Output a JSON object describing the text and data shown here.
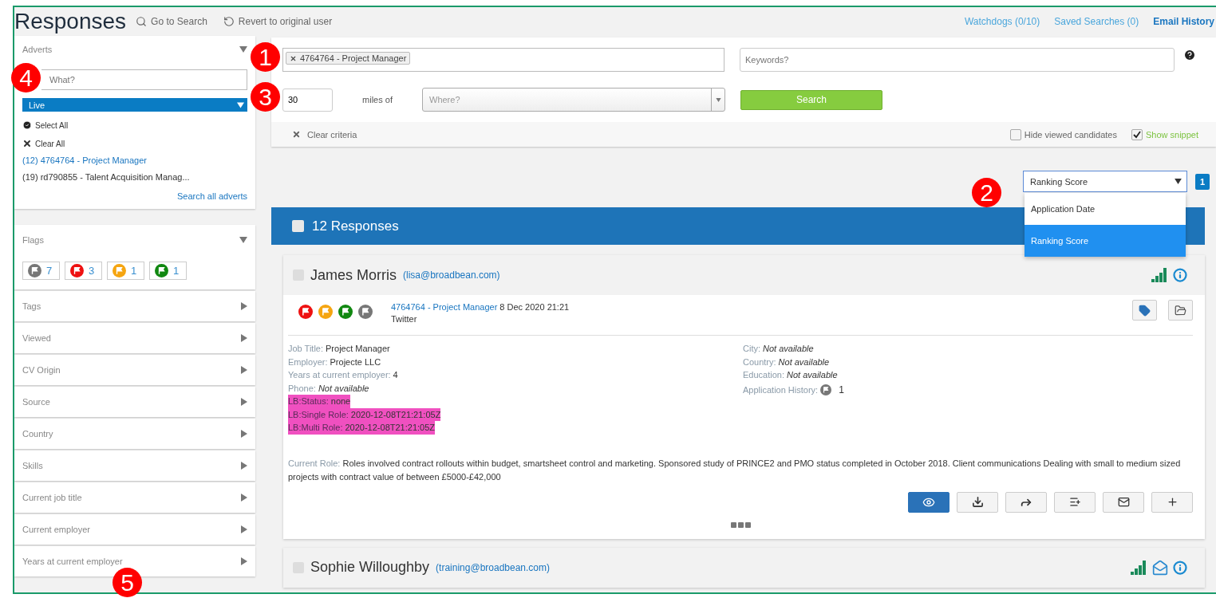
{
  "header": {
    "title": "Responses",
    "actions": [
      {
        "kind": "search",
        "label": "Go to Search"
      },
      {
        "kind": "revert",
        "label": "Revert to original user"
      }
    ],
    "links": [
      {
        "label": "Watchdogs (0/10)",
        "emphasis": false
      },
      {
        "label": "Saved Searches (0)",
        "emphasis": false
      },
      {
        "label": "Email History",
        "emphasis": true
      }
    ]
  },
  "adverts": {
    "title": "Adverts",
    "expanded": true,
    "what_placeholder": "What?",
    "status": "Live",
    "select_all": "Select All",
    "clear_all": "Clear All",
    "items": [
      {
        "count": "(12)",
        "label": "4764764 - Project Manager",
        "selected": true
      },
      {
        "count": "(19)",
        "label": "rd790855 - Talent Acquisition Manag...",
        "selected": false
      }
    ],
    "search_all": "Search all adverts"
  },
  "filters": [
    {
      "label": "Flags",
      "expanded": true,
      "flags": [
        {
          "color": "#777777",
          "count": "7"
        },
        {
          "color": "#ee1111",
          "count": "3"
        },
        {
          "color": "#f5a511",
          "count": "1"
        },
        {
          "color": "#118811",
          "count": "1"
        }
      ]
    },
    {
      "label": "Tags",
      "expanded": false
    },
    {
      "label": "Viewed",
      "expanded": false
    },
    {
      "label": "CV Origin",
      "expanded": false
    },
    {
      "label": "Source",
      "expanded": false
    },
    {
      "label": "Country",
      "expanded": false
    },
    {
      "label": "Skills",
      "expanded": false
    },
    {
      "label": "Current job title",
      "expanded": false
    },
    {
      "label": "Current employer",
      "expanded": false
    },
    {
      "label": "Years at current employer",
      "expanded": false
    }
  ],
  "search": {
    "advert_tags": [
      "4764764 - Project Manager"
    ],
    "keywords_placeholder": "Keywords?",
    "distance": "30",
    "distance_label": "miles of",
    "where_placeholder": "Where?",
    "button": "Search",
    "clear": "Clear criteria",
    "options": [
      {
        "label": "Hide viewed candidates",
        "checked": false
      },
      {
        "label": "Show snippet",
        "checked": true
      }
    ]
  },
  "sort": {
    "value": "Ranking Score",
    "options": [
      {
        "label": "Application Date",
        "selected": false
      },
      {
        "label": "Ranking Score",
        "selected": true
      }
    ],
    "page": "1"
  },
  "results": {
    "count_label": "12 Responses",
    "all_checked": false,
    "candidates": [
      {
        "name": "James Morris",
        "email": "(lisa@broadbean.com)",
        "checked": false,
        "emailed": false,
        "flags": [
          {
            "color": "#ee1111"
          },
          {
            "color": "#f5a511"
          },
          {
            "color": "#118811"
          },
          {
            "color": "#777777"
          }
        ],
        "advert": "4764764 - Project Manager",
        "date": "8 Dec 2020 21:21",
        "source": "Twitter",
        "details_left": [
          {
            "label": "Job Title:",
            "value": "Project Manager",
            "italic": false,
            "highlighted": false
          },
          {
            "label": "Employer:",
            "value": "Projecte LLC",
            "italic": false,
            "highlighted": false
          },
          {
            "label": "Years at current employer:",
            "value": "4",
            "italic": false,
            "highlighted": false
          },
          {
            "label": "Phone:",
            "value": "Not available",
            "italic": true,
            "highlighted": false
          },
          {
            "label": "LB:Status:",
            "value": "none",
            "italic": false,
            "highlighted": true
          },
          {
            "label": "LB:Single Role:",
            "value": "2020-12-08T21:21:05Z",
            "italic": false,
            "highlighted": true
          },
          {
            "label": "LB:Multi Role:",
            "value": "2020-12-08T21:21:05Z",
            "italic": false,
            "highlighted": true
          }
        ],
        "details_right": [
          {
            "kind": "text",
            "label": "City:",
            "value": "Not available",
            "italic": true
          },
          {
            "kind": "text",
            "label": "Country:",
            "value": "Not available",
            "italic": true
          },
          {
            "kind": "text",
            "label": "Education:",
            "value": "Not available",
            "italic": true
          },
          {
            "kind": "history",
            "label": "Application History:",
            "value": "1",
            "italic": false
          }
        ],
        "role_label": "Current Role:",
        "role_text": "Roles involved contract rollouts within budget, smartsheet control and marketing. Sponsored study of PRINCE2 and PMO status completed in October 2018. Client communications Dealing with small to medium sized projects with contract value of between £5000-£42,000"
      },
      {
        "name": "Sophie Willoughby",
        "email": "(training@broadbean.com)",
        "checked": false,
        "emailed": true
      }
    ]
  },
  "callouts": [
    "1",
    "2",
    "3",
    "4",
    "5"
  ]
}
